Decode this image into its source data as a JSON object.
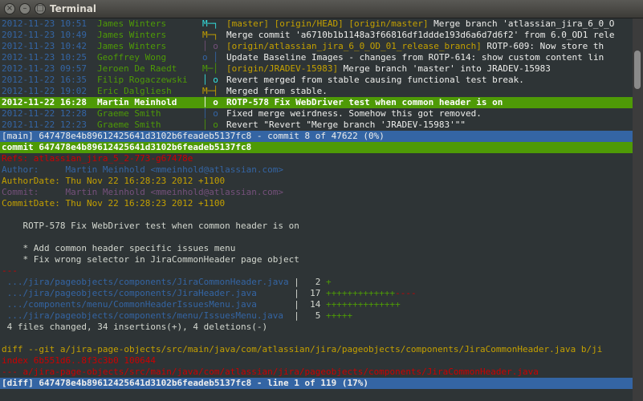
{
  "window": {
    "title": "Terminal"
  },
  "titlebar": {
    "close_label": "×",
    "minimize_label": "–",
    "maximize_label": "□"
  },
  "log": [
    {
      "date": "2012-11-23 10:51",
      "author": "James Winters",
      "graph": "M─┐",
      "refs": "[master] [origin/HEAD] [origin/master]",
      "msg": " Merge branch 'atlassian_jira_6_0_O"
    },
    {
      "date": "2012-11-23 10:49",
      "author": "James Winters",
      "graph": "M─┐",
      "refs": "",
      "msg": "Merge commit 'a6710b1b1148a3f66816df1ddde193d6a6d7d6f2' from 6.0_OD1 rele"
    },
    {
      "date": "2012-11-23 10:42",
      "author": "James Winters",
      "graph": "│ o",
      "refs": "[origin/atlassian_jira_6_0_OD_01_release_branch]",
      "msg": " ROTP-609: Now store th"
    },
    {
      "date": "2012-11-23 10:25",
      "author": "Geoffrey Wong",
      "graph": "o │",
      "refs": "",
      "msg": "Update Baseline Images - changes from ROTP-614: show custom content lin"
    },
    {
      "date": "2012-11-23 09:57",
      "author": "Jeroen De Raedt",
      "graph": "M─│",
      "refs": "[origin/JRADEV-15983]",
      "msg": " Merge branch 'master' into JRADEV-15983"
    },
    {
      "date": "2012-11-22 16:35",
      "author": "Filip Rogaczewski",
      "graph": "│ o",
      "refs": "",
      "msg": "Revert merged from stable causing functional test break."
    },
    {
      "date": "2012-11-22 19:02",
      "author": "Eric Dalgliesh",
      "graph": "M─┤",
      "refs": "",
      "msg": "Merged from stable."
    },
    {
      "date": "2012-11-22 16:28",
      "author": "Martin Meinhold",
      "graph": "│ o",
      "refs": "",
      "msg": "ROTP-578 Fix WebDriver test when common header is on"
    },
    {
      "date": "2012-11-22 12:28",
      "author": "Graeme Smith",
      "graph": "│ o",
      "refs": "",
      "msg": "Fixed merge weirdness. Somehow this got removed."
    },
    {
      "date": "2012-11-22 12:23",
      "author": "Graeme Smith",
      "graph": "│ o",
      "refs": "",
      "msg": "Revert \"Revert \"Merge branch 'JRADEV-15983'\"\""
    }
  ],
  "status_main": "[main] 647478e4b89612425641d3102b6feadeb5137fc8 - commit 8 of 47622 (0%)",
  "commit_line": "commit 647478e4b89612425641d3102b6feadeb5137fc8",
  "refs_line": "Refs: atlassian_jira_5_2-773-g67478e",
  "author_line": {
    "label": "Author:     ",
    "value": "Martin Meinhold <mmeinhold@atlassian.com>"
  },
  "authordate_line": "AuthorDate: Thu Nov 22 16:28:23 2012 +1100",
  "committer_line": {
    "label": "Commit:     ",
    "value": "Martin Meinhold <mmeinhold@atlassian.com>"
  },
  "commitdate_line": "CommitDate: Thu Nov 22 16:28:23 2012 +1100",
  "message": {
    "subject": "    ROTP-578 Fix WebDriver test when common header is on",
    "bullet1": "    * Add common header specific issues menu",
    "bullet2": "    * Fix wrong selector in JiraCommonHeader page object"
  },
  "diffstat_sep": "---",
  "diffstat": [
    {
      "file": " .../jira/pageobjects/components/JiraCommonHeader.java",
      "sep": " | ",
      "count": "  2",
      "plus": " +",
      "minus": ""
    },
    {
      "file": " .../jira/pageobjects/components/JiraHeader.java      ",
      "sep": " | ",
      "count": " 17",
      "plus": " +++++++++++++",
      "minus": "----"
    },
    {
      "file": " .../components/menu/CommonHeaderIssuesMenu.java      ",
      "sep": " | ",
      "count": " 14",
      "plus": " ++++++++++++++",
      "minus": ""
    },
    {
      "file": " .../jira/pageobjects/components/menu/IssuesMenu.java ",
      "sep": " | ",
      "count": "  5",
      "plus": " +++++",
      "minus": ""
    }
  ],
  "diffstat_summary": " 4 files changed, 34 insertions(+), 4 deletions(-)",
  "diff_header": "diff --git a/jira-page-objects/src/main/java/com/atlassian/jira/pageobjects/components/JiraCommonHeader.java b/ji",
  "diff_index": "index 6b551d6..8f3c3b0 100644",
  "diff_file": "--- a/jira-page-objects/src/main/java/com/atlassian/jira/pageobjects/components/JiraCommonHeader.java",
  "status_diff": "[diff] 647478e4b89612425641d3102b6feadeb5137fc8 - line 1 of 119 (17%)"
}
